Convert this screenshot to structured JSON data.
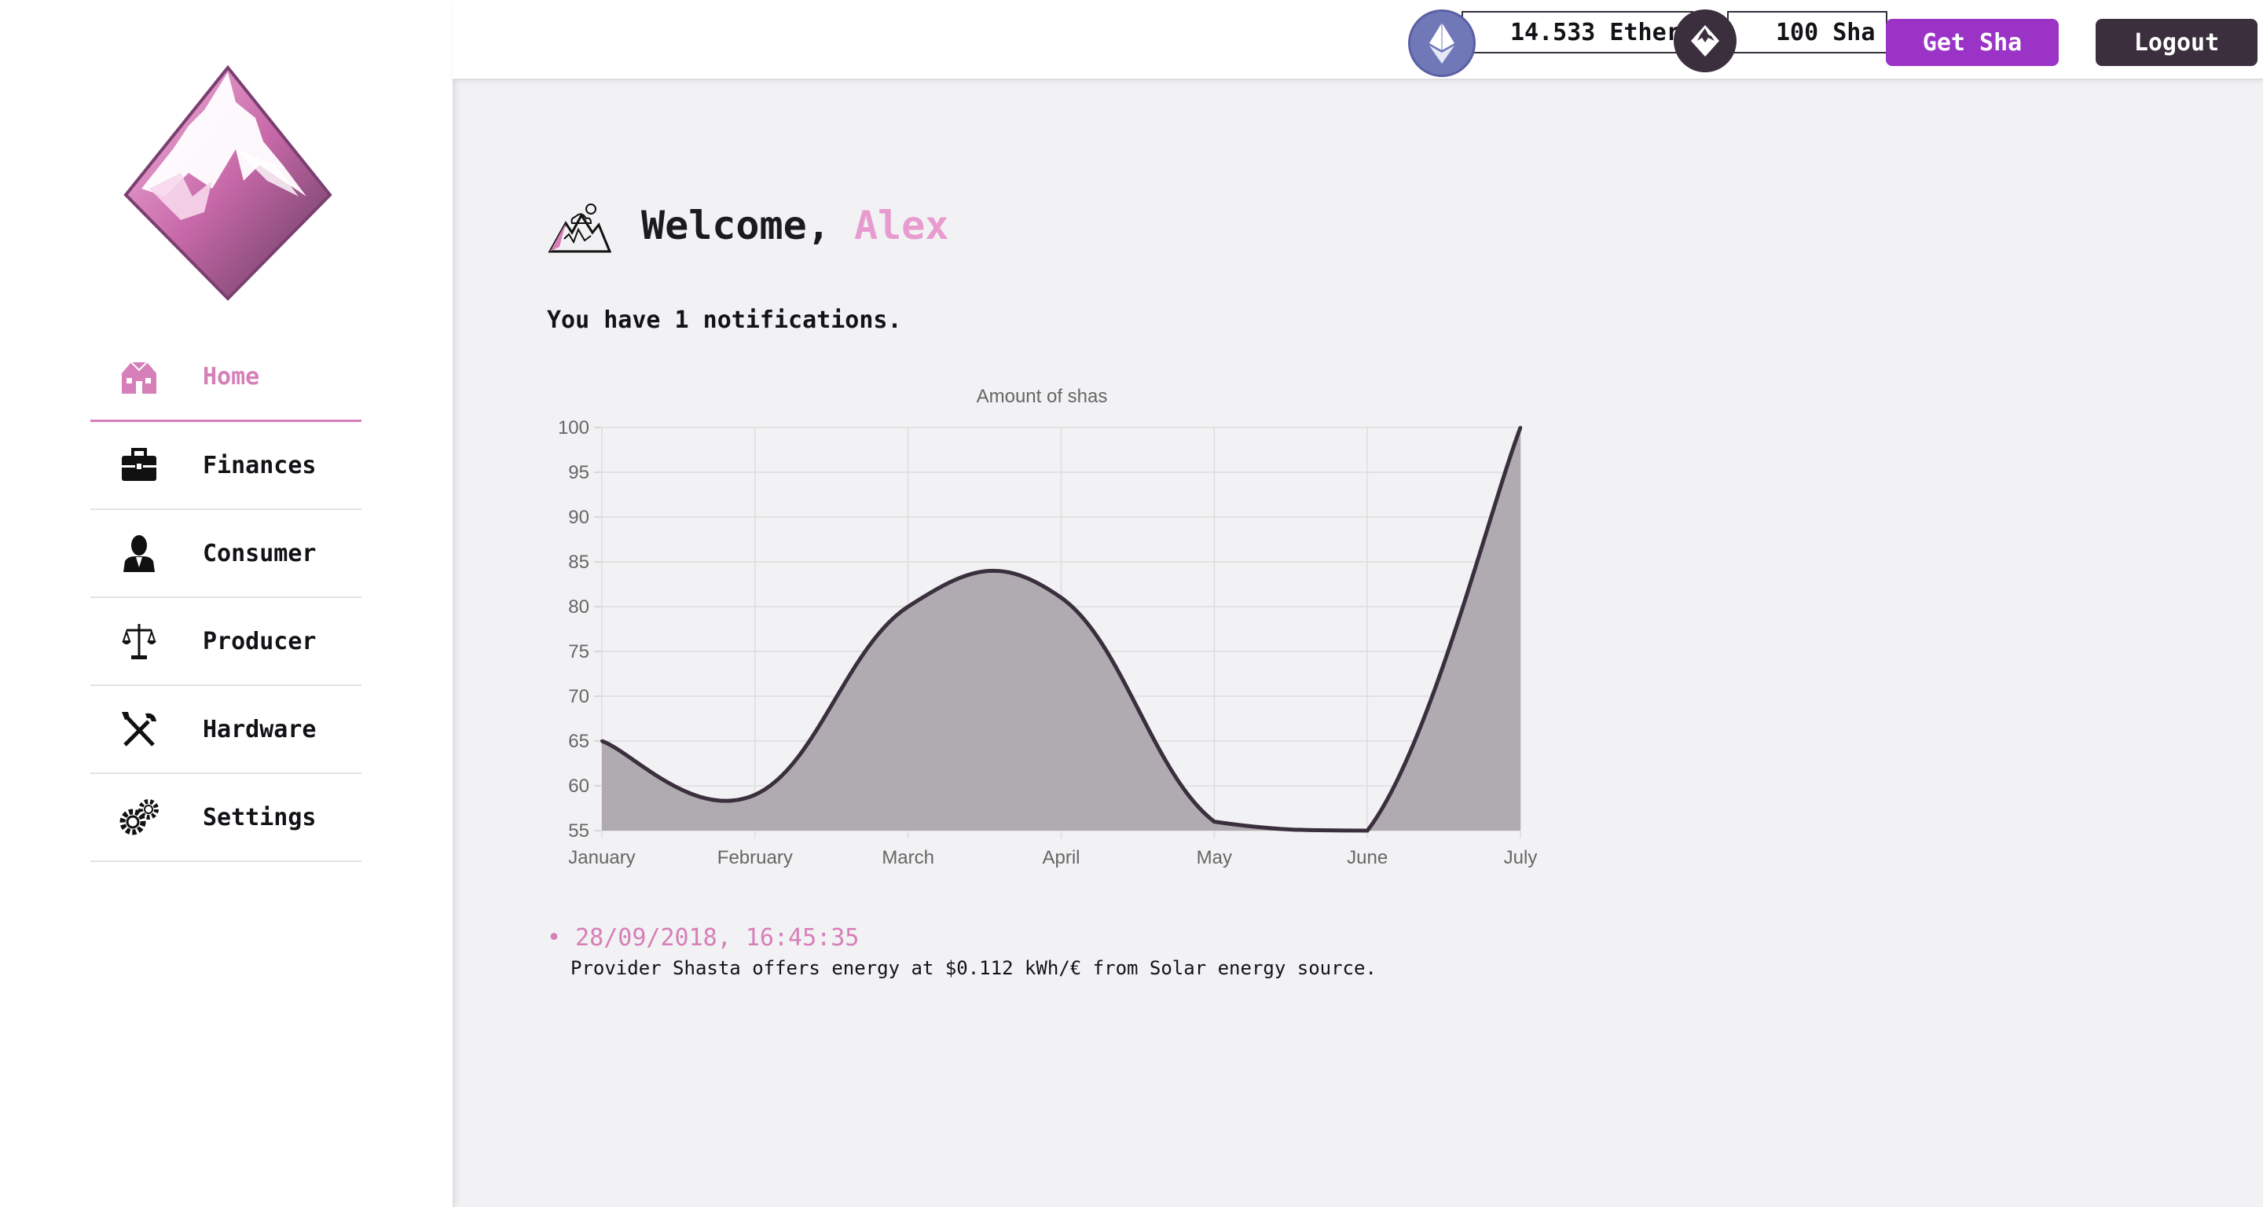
{
  "sidebar": {
    "items": [
      {
        "label": "Home",
        "icon": "house-icon",
        "active": true
      },
      {
        "label": "Finances",
        "icon": "briefcase-icon",
        "active": false
      },
      {
        "label": "Consumer",
        "icon": "person-icon",
        "active": false
      },
      {
        "label": "Producer",
        "icon": "scales-icon",
        "active": false
      },
      {
        "label": "Hardware",
        "icon": "tools-icon",
        "active": false
      },
      {
        "label": "Settings",
        "icon": "gears-icon",
        "active": false
      }
    ]
  },
  "topbar": {
    "ether_balance": "14.533 Ether",
    "sha_balance": "100 Sha",
    "get_sha_label": "Get Sha",
    "logout_label": "Logout"
  },
  "main": {
    "welcome_prefix": "Welcome, ",
    "user_name": "Alex",
    "notification_count_text": "You have 1 notifications.",
    "notifications": [
      {
        "date": "28/09/2018, 16:45:35",
        "text": "Provider Shasta offers energy at $0.112 kWh/€ from Solar energy source."
      }
    ]
  },
  "colors": {
    "accent_pink": "#d67fb8",
    "name_pink": "#e89bcf",
    "purple_button": "#9b34c6",
    "dark": "#3b2f3e",
    "ether_blue": "#7178b8",
    "area_fill": "#b0aab1",
    "line": "#3a2f3d"
  },
  "chart_data": {
    "type": "area",
    "title": "Amount of shas",
    "categories": [
      "January",
      "February",
      "March",
      "April",
      "May",
      "June",
      "July"
    ],
    "series": [
      {
        "values": [
          65,
          59,
          80,
          81,
          56,
          55,
          100
        ]
      }
    ],
    "ylim": [
      55,
      100
    ],
    "yticks": [
      55,
      60,
      65,
      70,
      75,
      80,
      85,
      90,
      95,
      100
    ],
    "grid": true
  }
}
